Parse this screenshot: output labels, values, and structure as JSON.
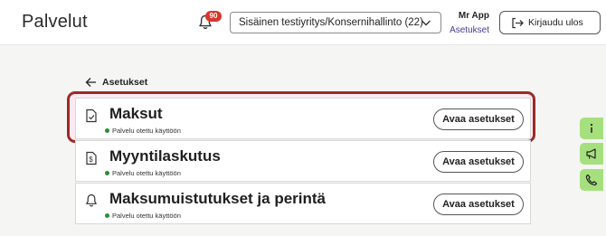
{
  "header": {
    "title": "Palvelut",
    "notification_count": "90",
    "company_select": "Sisäinen testiyritys/Konsernihallinto (22)",
    "user_name": "Mr App",
    "settings_link": "Asetukset",
    "logout_label": "Kirjaudu ulos"
  },
  "breadcrumb": {
    "back_label": "Asetukset"
  },
  "services": [
    {
      "title": "Maksut",
      "status": "Palvelu otettu käyttöön",
      "button": "Avaa asetukset",
      "icon": "document-check-icon"
    },
    {
      "title": "Myyntilaskutus",
      "status": "Palvelu otettu käyttöön",
      "button": "Avaa asetukset",
      "icon": "invoice-dollar-icon"
    },
    {
      "title": "Maksumuistutukset ja perintä",
      "status": "Palvelu otettu käyttöön",
      "button": "Avaa asetukset",
      "icon": "bell-icon"
    }
  ],
  "side_panel": [
    "info-icon",
    "megaphone-icon",
    "phone-icon"
  ],
  "colors": {
    "badge": "#d9362b",
    "highlight_border": "#9b2b24",
    "status_dot": "#2e8b3a",
    "side_buttons": "#a6e07e",
    "link": "#4b3a91"
  }
}
